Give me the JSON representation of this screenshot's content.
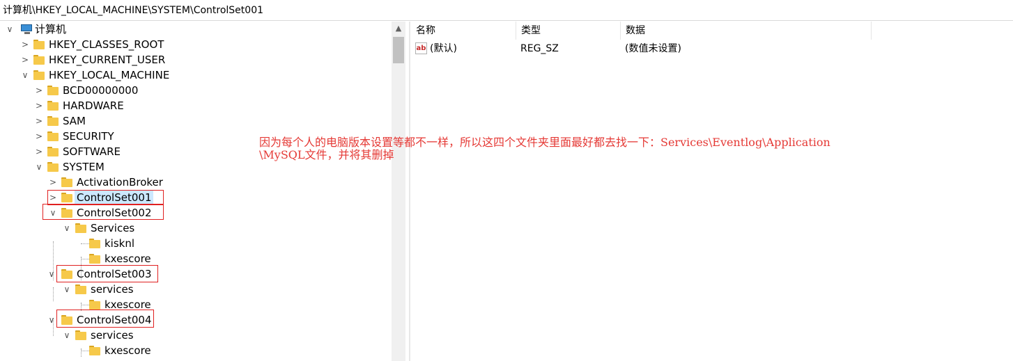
{
  "address_bar": {
    "path": "计算机\\HKEY_LOCAL_MACHINE\\SYSTEM\\ControlSet001"
  },
  "tree": {
    "root": "计算机",
    "hkcr": "HKEY_CLASSES_ROOT",
    "hkcu": "HKEY_CURRENT_USER",
    "hklm": "HKEY_LOCAL_MACHINE",
    "bcd": "BCD00000000",
    "hardware": "HARDWARE",
    "sam": "SAM",
    "security": "SECURITY",
    "software": "SOFTWARE",
    "system": "SYSTEM",
    "activation_broker": "ActivationBroker",
    "cs001": "ControlSet001",
    "cs002": "ControlSet002",
    "cs002_services": "Services",
    "cs002_kisknl": "kisknl",
    "cs002_kxescore": "kxescore",
    "cs003": "ControlSet003",
    "cs003_services": "services",
    "cs003_kxescore": "kxescore",
    "cs004": "ControlSet004",
    "cs004_services": "services",
    "cs004_kxescore": "kxescore"
  },
  "values_list": {
    "headers": {
      "name": "名称",
      "type": "类型",
      "data": "数据"
    },
    "rows": [
      {
        "name": "(默认)",
        "type": "REG_SZ",
        "data": "(数值未设置)",
        "icon": "string-value-icon"
      }
    ]
  },
  "annotation": {
    "line1": "因为每个人的电脑版本设置等都不一样，所以这四个文件夹里面最好都去找一下：Services\\Eventlog\\Application",
    "line2": "\\MySQL文件，并将其删掉",
    "color": "#e53935"
  },
  "colors": {
    "selection": "#cce8ff",
    "highlight_box": "#e02020",
    "folder": "#f6c94a"
  }
}
